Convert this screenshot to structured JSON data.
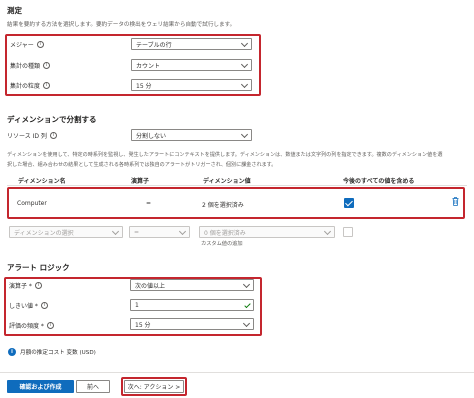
{
  "measure": {
    "heading": "測定",
    "description": "結果を要約する方法を選択します。要約データの検出をウェリ結果から自動で試行します。",
    "fields": [
      {
        "label": "メジャー",
        "value": "テーブルの行"
      },
      {
        "label": "集計の種類",
        "value": "カウント"
      },
      {
        "label": "集計の粒度",
        "value": "15 分"
      }
    ]
  },
  "split": {
    "heading": "ディメンションで分割する",
    "resource_label": "リソース ID 列",
    "resource_value": "分割しない",
    "description_line1": "ディメンションを使用して、特定の時系列を監視し、発生したアラートにコンテキストを提供します。ディメンションは、数値または文字列の列を指定できます。複数のディメンション値を選",
    "description_line2": "択した場合、組み合わせの結果として生成される各時系列では独自のアラートがトリガーされ、個別に課金されます。",
    "columns": {
      "dimension": "ディメンション名",
      "operator": "演算子",
      "values": "ディメンション値",
      "include_future": "今後のすべての値を含める"
    },
    "row": {
      "dimension": "Computer",
      "operator": "=",
      "values": "2 個を選択済み",
      "include_future": true
    },
    "new_row": {
      "dimension_placeholder": "ディメンションの選択",
      "operator": "=",
      "values_placeholder": "0 個を選択済み",
      "add_custom": "カスタム値の追加"
    }
  },
  "alert_logic": {
    "heading": "アラート ロジック",
    "fields": [
      {
        "label": "演算子 *",
        "value": "次の値以上"
      },
      {
        "label": "しきい値 *",
        "value": "1"
      },
      {
        "label": "評価の頻度 *",
        "value": "15 分"
      }
    ]
  },
  "cost": {
    "text": "月額の推定コスト 変数 (USD)"
  },
  "footer": {
    "review_create": "確認および作成",
    "previous": "前へ",
    "next": "次へ: アクション >"
  },
  "colors": {
    "accent": "#0f6cbd",
    "highlight": "#c4262e",
    "valid": "#107c10"
  }
}
